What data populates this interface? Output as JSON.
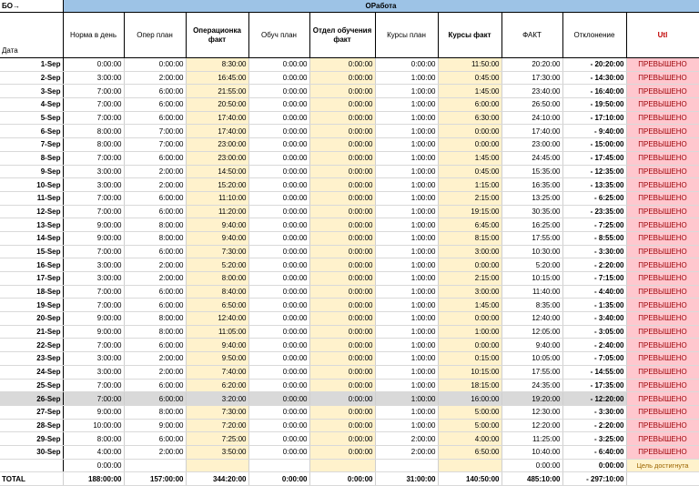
{
  "top": {
    "label": "БО→",
    "band": "ОРабота"
  },
  "headers": [
    "Дата",
    "Норма в день",
    "Опер план",
    "Операционка факт",
    "Обуч план",
    "Отдел обучения факт",
    "Курсы план",
    "Курсы факт",
    "ФАКТ",
    "Отклонение",
    "Utl"
  ],
  "rows": [
    [
      "1-Sep",
      "0:00:00",
      "0:00:00",
      "8:30:00",
      "0:00:00",
      "0:00:00",
      "0:00:00",
      "11:50:00",
      "20:20:00",
      "- 20:20:00",
      "ПРЕВЫШЕНО"
    ],
    [
      "2-Sep",
      "3:00:00",
      "2:00:00",
      "16:45:00",
      "0:00:00",
      "0:00:00",
      "1:00:00",
      "0:45:00",
      "17:30:00",
      "- 14:30:00",
      "ПРЕВЫШЕНО"
    ],
    [
      "3-Sep",
      "7:00:00",
      "6:00:00",
      "21:55:00",
      "0:00:00",
      "0:00:00",
      "1:00:00",
      "1:45:00",
      "23:40:00",
      "- 16:40:00",
      "ПРЕВЫШЕНО"
    ],
    [
      "4-Sep",
      "7:00:00",
      "6:00:00",
      "20:50:00",
      "0:00:00",
      "0:00:00",
      "1:00:00",
      "6:00:00",
      "26:50:00",
      "- 19:50:00",
      "ПРЕВЫШЕНО"
    ],
    [
      "5-Sep",
      "7:00:00",
      "6:00:00",
      "17:40:00",
      "0:00:00",
      "0:00:00",
      "1:00:00",
      "6:30:00",
      "24:10:00",
      "- 17:10:00",
      "ПРЕВЫШЕНО"
    ],
    [
      "6-Sep",
      "8:00:00",
      "7:00:00",
      "17:40:00",
      "0:00:00",
      "0:00:00",
      "1:00:00",
      "0:00:00",
      "17:40:00",
      "- 9:40:00",
      "ПРЕВЫШЕНО"
    ],
    [
      "7-Sep",
      "8:00:00",
      "7:00:00",
      "23:00:00",
      "0:00:00",
      "0:00:00",
      "1:00:00",
      "0:00:00",
      "23:00:00",
      "- 15:00:00",
      "ПРЕВЫШЕНО"
    ],
    [
      "8-Sep",
      "7:00:00",
      "6:00:00",
      "23:00:00",
      "0:00:00",
      "0:00:00",
      "1:00:00",
      "1:45:00",
      "24:45:00",
      "- 17:45:00",
      "ПРЕВЫШЕНО"
    ],
    [
      "9-Sep",
      "3:00:00",
      "2:00:00",
      "14:50:00",
      "0:00:00",
      "0:00:00",
      "1:00:00",
      "0:45:00",
      "15:35:00",
      "- 12:35:00",
      "ПРЕВЫШЕНО"
    ],
    [
      "10-Sep",
      "3:00:00",
      "2:00:00",
      "15:20:00",
      "0:00:00",
      "0:00:00",
      "1:00:00",
      "1:15:00",
      "16:35:00",
      "- 13:35:00",
      "ПРЕВЫШЕНО"
    ],
    [
      "11-Sep",
      "7:00:00",
      "6:00:00",
      "11:10:00",
      "0:00:00",
      "0:00:00",
      "1:00:00",
      "2:15:00",
      "13:25:00",
      "- 6:25:00",
      "ПРЕВЫШЕНО"
    ],
    [
      "12-Sep",
      "7:00:00",
      "6:00:00",
      "11:20:00",
      "0:00:00",
      "0:00:00",
      "1:00:00",
      "19:15:00",
      "30:35:00",
      "- 23:35:00",
      "ПРЕВЫШЕНО"
    ],
    [
      "13-Sep",
      "9:00:00",
      "8:00:00",
      "9:40:00",
      "0:00:00",
      "0:00:00",
      "1:00:00",
      "6:45:00",
      "16:25:00",
      "- 7:25:00",
      "ПРЕВЫШЕНО"
    ],
    [
      "14-Sep",
      "9:00:00",
      "8:00:00",
      "9:40:00",
      "0:00:00",
      "0:00:00",
      "1:00:00",
      "8:15:00",
      "17:55:00",
      "- 8:55:00",
      "ПРЕВЫШЕНО"
    ],
    [
      "15-Sep",
      "7:00:00",
      "6:00:00",
      "7:30:00",
      "0:00:00",
      "0:00:00",
      "1:00:00",
      "3:00:00",
      "10:30:00",
      "- 3:30:00",
      "ПРЕВЫШЕНО"
    ],
    [
      "16-Sep",
      "3:00:00",
      "2:00:00",
      "5:20:00",
      "0:00:00",
      "0:00:00",
      "1:00:00",
      "0:00:00",
      "5:20:00",
      "- 2:20:00",
      "ПРЕВЫШЕНО"
    ],
    [
      "17-Sep",
      "3:00:00",
      "2:00:00",
      "8:00:00",
      "0:00:00",
      "0:00:00",
      "1:00:00",
      "2:15:00",
      "10:15:00",
      "- 7:15:00",
      "ПРЕВЫШЕНО"
    ],
    [
      "18-Sep",
      "7:00:00",
      "6:00:00",
      "8:40:00",
      "0:00:00",
      "0:00:00",
      "1:00:00",
      "3:00:00",
      "11:40:00",
      "- 4:40:00",
      "ПРЕВЫШЕНО"
    ],
    [
      "19-Sep",
      "7:00:00",
      "6:00:00",
      "6:50:00",
      "0:00:00",
      "0:00:00",
      "1:00:00",
      "1:45:00",
      "8:35:00",
      "- 1:35:00",
      "ПРЕВЫШЕНО"
    ],
    [
      "20-Sep",
      "9:00:00",
      "8:00:00",
      "12:40:00",
      "0:00:00",
      "0:00:00",
      "1:00:00",
      "0:00:00",
      "12:40:00",
      "- 3:40:00",
      "ПРЕВЫШЕНО"
    ],
    [
      "21-Sep",
      "9:00:00",
      "8:00:00",
      "11:05:00",
      "0:00:00",
      "0:00:00",
      "1:00:00",
      "1:00:00",
      "12:05:00",
      "- 3:05:00",
      "ПРЕВЫШЕНО"
    ],
    [
      "22-Sep",
      "7:00:00",
      "6:00:00",
      "9:40:00",
      "0:00:00",
      "0:00:00",
      "1:00:00",
      "0:00:00",
      "9:40:00",
      "- 2:40:00",
      "ПРЕВЫШЕНО"
    ],
    [
      "23-Sep",
      "3:00:00",
      "2:00:00",
      "9:50:00",
      "0:00:00",
      "0:00:00",
      "1:00:00",
      "0:15:00",
      "10:05:00",
      "- 7:05:00",
      "ПРЕВЫШЕНО"
    ],
    [
      "24-Sep",
      "3:00:00",
      "2:00:00",
      "7:40:00",
      "0:00:00",
      "0:00:00",
      "1:00:00",
      "10:15:00",
      "17:55:00",
      "- 14:55:00",
      "ПРЕВЫШЕНО"
    ],
    [
      "25-Sep",
      "7:00:00",
      "6:00:00",
      "6:20:00",
      "0:00:00",
      "0:00:00",
      "1:00:00",
      "18:15:00",
      "24:35:00",
      "- 17:35:00",
      "ПРЕВЫШЕНО"
    ],
    [
      "26-Sep",
      "7:00:00",
      "6:00:00",
      "3:20:00",
      "0:00:00",
      "0:00:00",
      "1:00:00",
      "16:00:00",
      "19:20:00",
      "- 12:20:00",
      "ПРЕВЫШЕНО"
    ],
    [
      "27-Sep",
      "9:00:00",
      "8:00:00",
      "7:30:00",
      "0:00:00",
      "0:00:00",
      "1:00:00",
      "5:00:00",
      "12:30:00",
      "- 3:30:00",
      "ПРЕВЫШЕНО"
    ],
    [
      "28-Sep",
      "10:00:00",
      "9:00:00",
      "7:20:00",
      "0:00:00",
      "0:00:00",
      "1:00:00",
      "5:00:00",
      "12:20:00",
      "- 2:20:00",
      "ПРЕВЫШЕНО"
    ],
    [
      "29-Sep",
      "8:00:00",
      "6:00:00",
      "7:25:00",
      "0:00:00",
      "0:00:00",
      "2:00:00",
      "4:00:00",
      "11:25:00",
      "- 3:25:00",
      "ПРЕВЫШЕНО"
    ],
    [
      "30-Sep",
      "4:00:00",
      "2:00:00",
      "3:50:00",
      "0:00:00",
      "0:00:00",
      "2:00:00",
      "6:50:00",
      "10:40:00",
      "- 6:40:00",
      "ПРЕВЫШЕНО"
    ]
  ],
  "extra_row": [
    "",
    "0:00:00",
    "",
    "",
    "",
    "",
    "",
    "",
    "0:00:00",
    "0:00:00",
    "Цель достигнута"
  ],
  "total_row": [
    "TOTAL",
    "188:00:00",
    "157:00:00",
    "344:20:00",
    "0:00:00",
    "0:00:00",
    "31:00:00",
    "140:50:00",
    "485:10:00",
    "- 297:10:00",
    ""
  ],
  "selected_row_index": 25,
  "colors": {
    "band": "#9dc3e6",
    "fact_fill": "#fff2cc",
    "exceeded_fill": "#ffc7ce",
    "exceeded_text": "#9c0006",
    "achieved_fill": "#fff2cc",
    "utl_header": "#c00000"
  }
}
